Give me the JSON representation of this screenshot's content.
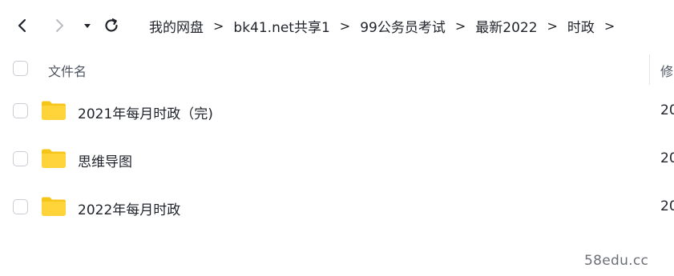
{
  "toolbar": {
    "back_icon": "chevron-left-icon",
    "forward_icon": "chevron-right-icon",
    "history_icon": "caret-down-icon",
    "refresh_icon": "refresh-icon"
  },
  "breadcrumb": {
    "items": [
      "我的网盘",
      "bk41.net共享1",
      "99公务员考试",
      "最新2022",
      "时政"
    ],
    "separator": ">"
  },
  "table": {
    "columns": {
      "name": "文件名",
      "modified": "修"
    },
    "rows": [
      {
        "name": "2021年每月时政（完)",
        "modified": "20",
        "icon": "folder-icon"
      },
      {
        "name": "思维导图",
        "modified": "20",
        "icon": "folder-icon"
      },
      {
        "name": "2022年每月时政",
        "modified": "20",
        "icon": "folder-icon"
      }
    ]
  },
  "colors": {
    "folder": "#ffd43b",
    "folder_tab": "#f5c518",
    "checkbox_border": "#c9ccd1",
    "text": "#1f2329"
  },
  "watermark": "58edu.cc"
}
